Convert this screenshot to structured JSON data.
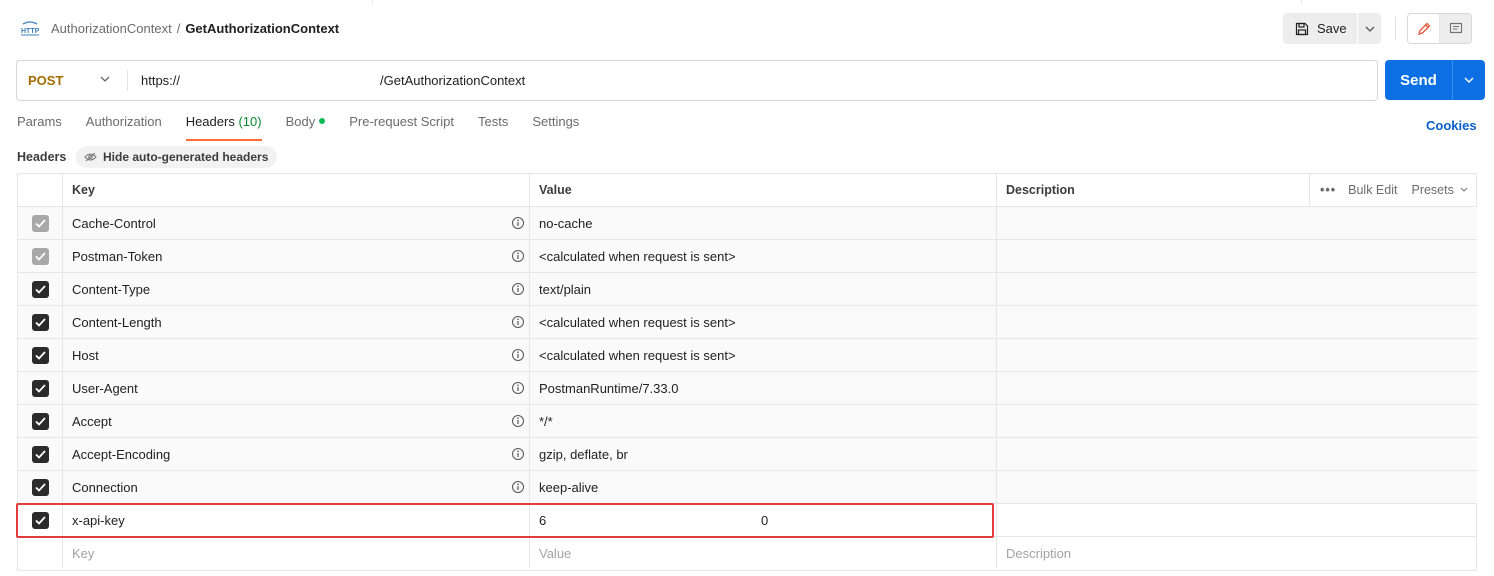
{
  "breadcrumb": {
    "parent": "AuthorizationContext",
    "separator": "/",
    "current": "GetAuthorizationContext"
  },
  "toolbar": {
    "save_label": "Save"
  },
  "request": {
    "method": "POST",
    "url_prefix": "https://",
    "url_suffix": "/GetAuthorizationContext",
    "send_label": "Send"
  },
  "tabs": [
    {
      "label": "Params"
    },
    {
      "label": "Authorization"
    },
    {
      "label": "Headers",
      "count": "(10)"
    },
    {
      "label": "Body"
    },
    {
      "label": "Pre-request Script"
    },
    {
      "label": "Tests"
    },
    {
      "label": "Settings"
    }
  ],
  "cookies_label": "Cookies",
  "headers_section": {
    "title": "Headers",
    "hide_label": "Hide auto-generated headers"
  },
  "table": {
    "columns": {
      "key": "Key",
      "value": "Value",
      "description": "Description"
    },
    "bulk_edit": "Bulk Edit",
    "presets": "Presets",
    "rows": [
      {
        "key": "Cache-Control",
        "value": "no-cache",
        "checked": true,
        "locked": true
      },
      {
        "key": "Postman-Token",
        "value": "<calculated when request is sent>",
        "checked": true,
        "locked": true
      },
      {
        "key": "Content-Type",
        "value": "text/plain",
        "checked": true,
        "locked": false
      },
      {
        "key": "Content-Length",
        "value": "<calculated when request is sent>",
        "checked": true,
        "locked": false
      },
      {
        "key": "Host",
        "value": "<calculated when request is sent>",
        "checked": true,
        "locked": false
      },
      {
        "key": "User-Agent",
        "value": "PostmanRuntime/7.33.0",
        "checked": true,
        "locked": false
      },
      {
        "key": "Accept",
        "value": "*/*",
        "checked": true,
        "locked": false
      },
      {
        "key": "Accept-Encoding",
        "value": "gzip, deflate, br",
        "checked": true,
        "locked": false
      },
      {
        "key": "Connection",
        "value": "keep-alive",
        "checked": true,
        "locked": false
      }
    ],
    "custom_row": {
      "key": "x-api-key",
      "value_start": "6",
      "value_end": "0"
    },
    "placeholders": {
      "key": "Key",
      "value": "Value",
      "description": "Description"
    }
  },
  "colors": {
    "method": "#a46b00",
    "send": "#0c6fe4",
    "active_tab_underline": "#ff6c37",
    "highlight_box": "#e23d3d",
    "link": "#0b5fca"
  }
}
